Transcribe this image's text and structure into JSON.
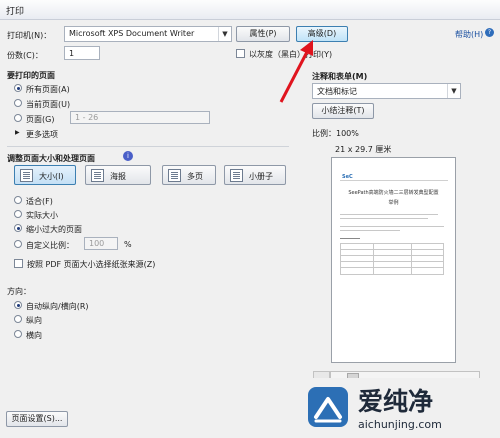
{
  "window": {
    "title": "打印"
  },
  "printer": {
    "label": "打印机(N)：",
    "selected": "Microsoft XPS Document Writer",
    "properties_label": "属性(P)",
    "advanced_label": "高级(D)",
    "help_label": "帮助(H)"
  },
  "copies": {
    "label": "份数(C)：",
    "value": "1"
  },
  "grayscale_label": "以灰度（黑白）打印(Y)",
  "pages_section": {
    "title": "要打印的页面",
    "all_label": "所有页面(A)",
    "current_label": "当前页面(U)",
    "pages_label": "页面(G)",
    "pages_value": "1 - 26",
    "more_label": "更多选项"
  },
  "sizing_section": {
    "title": "调整页面大小和处理页面",
    "info_icon": "info-icon",
    "tabs": [
      "大小(I)",
      "海报",
      "多页",
      "小册子"
    ],
    "fit_label": "适合(F)",
    "actual_label": "实际大小",
    "shrink_label": "缩小过大的页面",
    "custom_label": "自定义比例：",
    "custom_value": "100",
    "custom_unit": "%",
    "paper_source_label": "按照 PDF 页面大小选择纸张来源(Z)"
  },
  "orientation": {
    "title": "方向：",
    "auto_label": "自动纵向/横向(R)",
    "portrait_label": "纵向",
    "landscape_label": "横向"
  },
  "comments": {
    "title": "注释和表单(M)",
    "selected": "文档和标记",
    "summarize_label": "小结注释(T)"
  },
  "preview": {
    "scale_label": "比例：100%",
    "size_label": "21 x 29.7 厘米",
    "doc_logo": "SeC",
    "doc_title": "SeePath高端防火墙二三层转发典型配置",
    "doc_subtitle": "举例"
  },
  "page_setup_label": "页面设置(S)...",
  "watermark": {
    "text": "爱纯净",
    "url": "aichunjing.com"
  },
  "colors": {
    "accent": "#3c7fb1",
    "arrow": "#e0141e",
    "logo": "#2c6fb5"
  }
}
